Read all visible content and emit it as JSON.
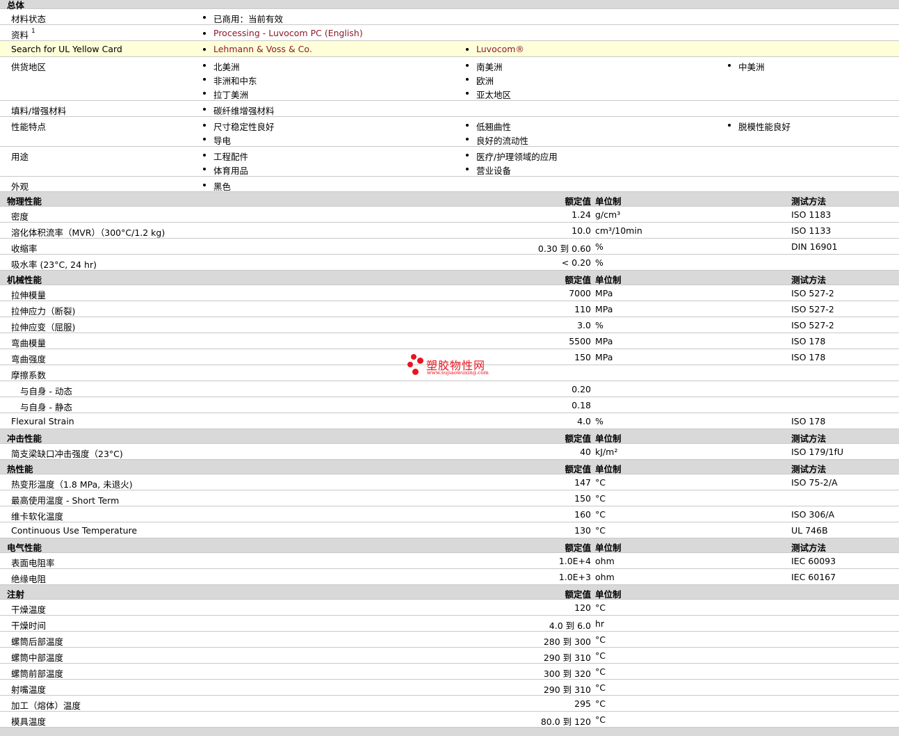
{
  "general": {
    "title": "总体",
    "material_status": {
      "label": "材料状态",
      "items": [
        "已商用：当前有效"
      ]
    },
    "documents": {
      "label": "资料",
      "sup": "1",
      "items": [
        "Processing - Luvocom PC (English)"
      ]
    },
    "ul_card": {
      "label": "Search for UL Yellow Card",
      "items": [
        "Lehmann & Voss & Co.",
        "Luvocom®"
      ]
    },
    "regions": {
      "label": "供货地区",
      "col1": [
        "北美洲",
        "非洲和中东",
        "拉丁美洲"
      ],
      "col2": [
        "南美洲",
        "欧洲",
        "亚太地区"
      ],
      "col3": [
        "中美洲"
      ]
    },
    "filler": {
      "label": "填料/增强材料",
      "col1": [
        "碳纤维增强材料"
      ]
    },
    "features": {
      "label": "性能特点",
      "col1": [
        "尺寸稳定性良好",
        "导电"
      ],
      "col2": [
        "低翘曲性",
        "良好的流动性"
      ],
      "col3": [
        "脱模性能良好"
      ]
    },
    "uses": {
      "label": "用途",
      "col1": [
        "工程配件",
        "体育用品"
      ],
      "col2": [
        "医疗/护理领域的应用",
        "营业设备"
      ]
    },
    "appearance": {
      "label": "外观",
      "col1": [
        "黑色"
      ]
    }
  },
  "headers": {
    "value": "额定值",
    "unit": "单位制",
    "test": "测试方法"
  },
  "physical": {
    "title": "物理性能",
    "rows": [
      {
        "label": "密度",
        "value": "1.24",
        "unit": "g/cm³",
        "test": "ISO 1183"
      },
      {
        "label": "溶化体积流率（MVR）（300°C/1.2 kg)",
        "value": "10.0",
        "unit": "cm³/10min",
        "test": "ISO 1133"
      },
      {
        "label": "收缩率",
        "value": "0.30 到  0.60",
        "unit": "%",
        "test": "DIN 16901"
      },
      {
        "label": "吸水率 (23°C, 24 hr)",
        "value": "< 0.20",
        "unit": "%",
        "test": ""
      }
    ]
  },
  "mechanical": {
    "title": "机械性能",
    "rows": [
      {
        "label": "拉伸模量",
        "value": "7000",
        "unit": "MPa",
        "test": "ISO 527-2"
      },
      {
        "label": "拉伸应力（断裂)",
        "value": "110",
        "unit": "MPa",
        "test": "ISO 527-2"
      },
      {
        "label": "拉伸应变（屈服)",
        "value": "3.0",
        "unit": "%",
        "test": "ISO 527-2"
      },
      {
        "label": "弯曲模量",
        "value": "5500",
        "unit": "MPa",
        "test": "ISO 178"
      },
      {
        "label": "弯曲强度",
        "value": "150",
        "unit": "MPa",
        "test": "ISO 178"
      },
      {
        "label": "摩擦系数",
        "value": "",
        "unit": "",
        "test": ""
      },
      {
        "label": "与自身  - 动态",
        "value": "0.20",
        "unit": "",
        "test": "",
        "sub": true
      },
      {
        "label": "与自身  - 静态",
        "value": "0.18",
        "unit": "",
        "test": "",
        "sub": true
      },
      {
        "label": "Flexural Strain",
        "value": "4.0",
        "unit": "%",
        "test": "ISO 178"
      }
    ]
  },
  "impact": {
    "title": "冲击性能",
    "rows": [
      {
        "label": "简支梁缺口冲击强度（23°C)",
        "value": "40",
        "unit": "kJ/m²",
        "test": "ISO 179/1fU"
      }
    ]
  },
  "thermal": {
    "title": "热性能",
    "rows": [
      {
        "label": "热变形温度（1.8 MPa, 未退火)",
        "value": "147",
        "unit": "°C",
        "test": "ISO 75-2/A"
      },
      {
        "label": "最高使用温度  - Short Term",
        "value": "150",
        "unit": "°C",
        "test": ""
      },
      {
        "label": "维卡软化温度",
        "value": "160",
        "unit": "°C",
        "test": "ISO 306/A"
      },
      {
        "label": "Continuous Use Temperature",
        "value": "130",
        "unit": "°C",
        "test": "UL 746B"
      }
    ]
  },
  "electrical": {
    "title": "电气性能",
    "rows": [
      {
        "label": "表面电阻率",
        "value": "1.0E+4",
        "unit": "ohm",
        "test": "IEC 60093"
      },
      {
        "label": "绝缘电阻",
        "value": "1.0E+3",
        "unit": "ohm",
        "test": "IEC 60167"
      }
    ]
  },
  "injection": {
    "title": "注射",
    "rows": [
      {
        "label": "干燥温度",
        "value": "120",
        "unit": "°C",
        "test": ""
      },
      {
        "label": "干燥时间",
        "value": "4.0 到  6.0",
        "unit": "hr",
        "test": ""
      },
      {
        "label": "螺筒后部温度",
        "value": "280 到  300",
        "unit": "°C",
        "test": ""
      },
      {
        "label": "螺筒中部温度",
        "value": "290 到  310",
        "unit": "°C",
        "test": ""
      },
      {
        "label": "螺筒前部温度",
        "value": "300 到  320",
        "unit": "°C",
        "test": ""
      },
      {
        "label": "射嘴温度",
        "value": "290 到  310",
        "unit": "°C",
        "test": ""
      },
      {
        "label": "加工（熔体）温度",
        "value": "295",
        "unit": "°C",
        "test": ""
      },
      {
        "label": "模具温度",
        "value": "80.0 到  120",
        "unit": "°C",
        "test": ""
      }
    ]
  },
  "watermark": {
    "title": "塑胶物性网",
    "url": "www.sujiaowuxing.com"
  }
}
